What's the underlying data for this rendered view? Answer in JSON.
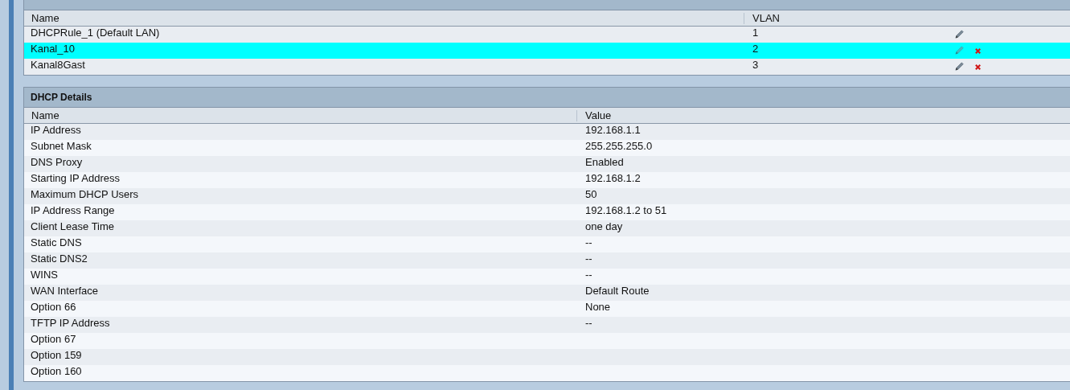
{
  "dhcp_list": {
    "columns": [
      "Name",
      "VLAN"
    ],
    "rows": [
      {
        "name": "DHCPRule_1 (Default LAN)",
        "vlan": "1",
        "selected": false,
        "editable": true,
        "deletable": false
      },
      {
        "name": "Kanal_10",
        "vlan": "2",
        "selected": true,
        "editable": true,
        "deletable": true
      },
      {
        "name": "Kanal8Gast",
        "vlan": "3",
        "selected": false,
        "editable": true,
        "deletable": true
      }
    ]
  },
  "dhcp_details": {
    "title": "DHCP Details",
    "columns": [
      "Name",
      "Value"
    ],
    "rows": [
      {
        "name": "IP Address",
        "value": "192.168.1.1"
      },
      {
        "name": "Subnet Mask",
        "value": "255.255.255.0"
      },
      {
        "name": "DNS Proxy",
        "value": "Enabled"
      },
      {
        "name": "Starting IP Address",
        "value": "192.168.1.2"
      },
      {
        "name": "Maximum DHCP Users",
        "value": "50"
      },
      {
        "name": "IP Address Range",
        "value": "192.168.1.2 to 51"
      },
      {
        "name": "Client Lease Time",
        "value": "one day"
      },
      {
        "name": "Static DNS",
        "value": "--"
      },
      {
        "name": "Static DNS2",
        "value": "--"
      },
      {
        "name": "WINS",
        "value": "--"
      },
      {
        "name": "WAN Interface",
        "value": "Default Route"
      },
      {
        "name": "Option 66",
        "value": "None"
      },
      {
        "name": "TFTP IP Address",
        "value": "--"
      },
      {
        "name": "Option 67"
      },
      {
        "name": "Option 159"
      },
      {
        "name": "Option 160"
      }
    ]
  }
}
